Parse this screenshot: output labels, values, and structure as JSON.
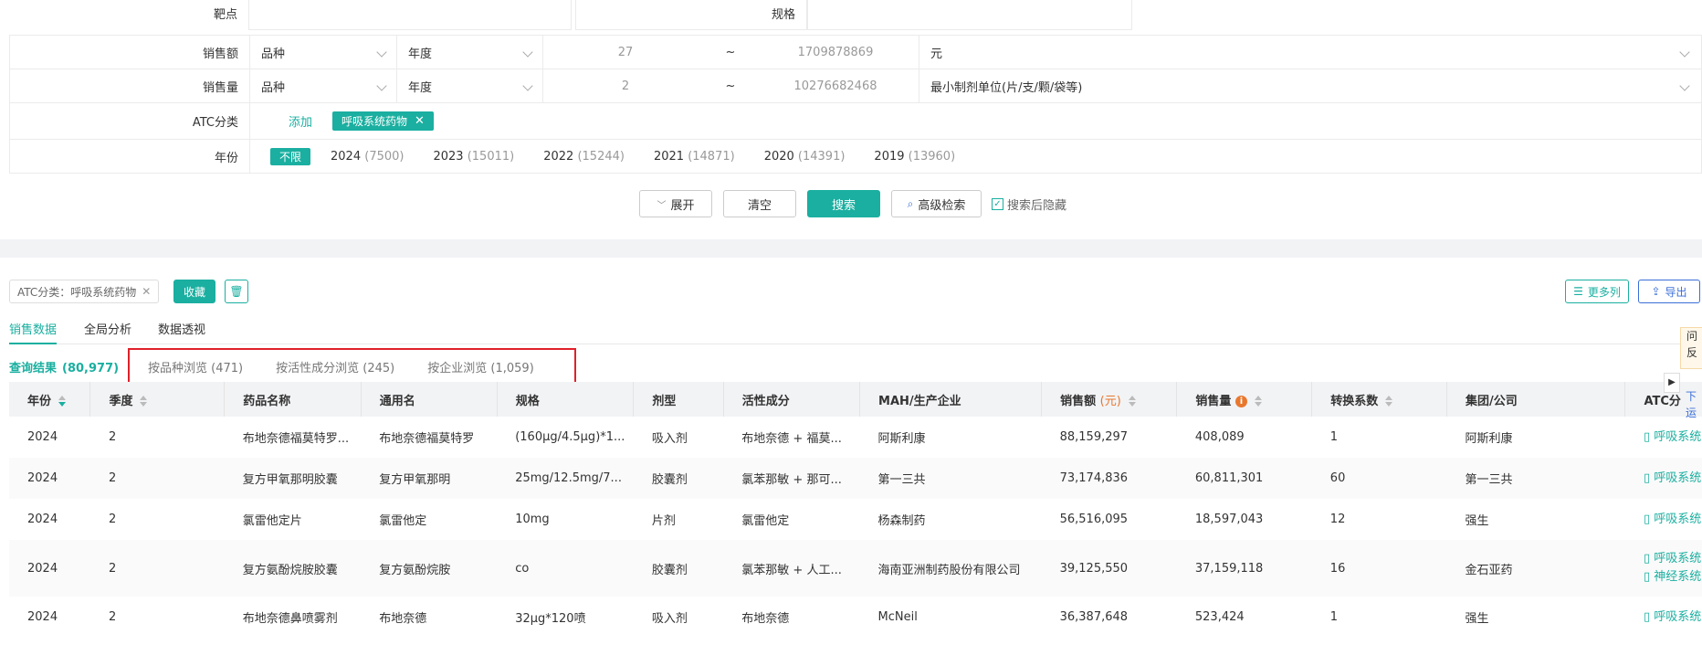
{
  "filter": {
    "target_label": "靶点",
    "spec_label": "规格",
    "sales_amount": {
      "label": "销售额",
      "variety": "品种",
      "year": "年度",
      "min": "27",
      "sep": "~",
      "max": "1709878869",
      "unit": "元"
    },
    "sales_volume": {
      "label": "销售量",
      "variety": "品种",
      "year": "年度",
      "min": "2",
      "sep": "~",
      "max": "10276682468",
      "unit": "最小制剂单位(片/支/颗/袋等)"
    },
    "atc": {
      "label": "ATC分类",
      "add": "添加",
      "tag": "呼吸系统药物"
    },
    "year_filter": {
      "label": "年份",
      "unlimited": "不限",
      "items": [
        {
          "year": "2024",
          "count": "(7500)"
        },
        {
          "year": "2023",
          "count": "(15011)"
        },
        {
          "year": "2022",
          "count": "(15244)"
        },
        {
          "year": "2021",
          "count": "(14871)"
        },
        {
          "year": "2020",
          "count": "(14391)"
        },
        {
          "year": "2019",
          "count": "(13960)"
        }
      ]
    }
  },
  "actions": {
    "expand": "展开",
    "clear": "清空",
    "search": "搜索",
    "advanced": "高级检索",
    "hide_after_search": "搜索后隐藏"
  },
  "toolbar": {
    "chip": "ATC分类：呼吸系统药物",
    "collect": "收藏",
    "more_columns": "更多列",
    "export": "导出"
  },
  "tabs": [
    "销售数据",
    "全局分析",
    "数据透视"
  ],
  "result": {
    "label": "查询结果",
    "count": "(80,977)"
  },
  "subtabs": [
    {
      "label": "按品种浏览",
      "count": "(471)"
    },
    {
      "label": "按活性成分浏览",
      "count": "(245)"
    },
    {
      "label": "按企业浏览",
      "count": "(1,059)"
    }
  ],
  "colors": {
    "accent": "#1aafa0",
    "highlight_box": "#e0202a",
    "yuan": "#e8772e"
  },
  "table": {
    "headers": [
      "年份",
      "季度",
      "药品名称",
      "通用名",
      "规格",
      "剂型",
      "活性成分",
      "MAH/生产企业",
      "销售额",
      "销售量",
      "转换系数",
      "集团/公司",
      "ATC分"
    ],
    "yuan": "(元)",
    "rows": [
      {
        "year": "2024",
        "q": "2",
        "name": "布地奈德福莫特罗...",
        "generic": "布地奈德福莫特罗",
        "spec": "(160μg/4.5μg)*1...",
        "form": "吸入剂",
        "active": "布地奈德 + 福莫...",
        "mah": "阿斯利康",
        "amount": "88,159,297",
        "volume": "408,089",
        "factor": "1",
        "group": "阿斯利康",
        "atc": [
          "呼吸系统"
        ]
      },
      {
        "year": "2024",
        "q": "2",
        "name": "复方甲氧那明胶囊",
        "generic": "复方甲氧那明",
        "spec": "25mg/12.5mg/7...",
        "form": "胶囊剂",
        "active": "氯苯那敏 + 那可...",
        "mah": "第一三共",
        "amount": "73,174,836",
        "volume": "60,811,301",
        "factor": "60",
        "group": "第一三共",
        "atc": [
          "呼吸系统"
        ]
      },
      {
        "year": "2024",
        "q": "2",
        "name": "氯雷他定片",
        "generic": "氯雷他定",
        "spec": "10mg",
        "form": "片剂",
        "active": "氯雷他定",
        "mah": "杨森制药",
        "amount": "56,516,095",
        "volume": "18,597,043",
        "factor": "12",
        "group": "强生",
        "atc": [
          "呼吸系统"
        ]
      },
      {
        "year": "2024",
        "q": "2",
        "name": "复方氨酚烷胺胶囊",
        "generic": "复方氨酚烷胺",
        "spec": "co",
        "form": "胶囊剂",
        "active": "氯苯那敏 + 人工...",
        "mah": "海南亚洲制药股份有限公司",
        "amount": "39,125,550",
        "volume": "37,159,118",
        "factor": "16",
        "group": "金石亚药",
        "atc": [
          "呼吸系统",
          "神经系统"
        ]
      },
      {
        "year": "2024",
        "q": "2",
        "name": "布地奈德鼻喷雾剂",
        "generic": "布地奈德",
        "spec": "32μg*120喷",
        "form": "吸入剂",
        "active": "布地奈德",
        "mah": "McNeil",
        "amount": "36,387,648",
        "volume": "523,424",
        "factor": "1",
        "group": "强生",
        "atc": [
          "呼吸系统"
        ]
      }
    ]
  },
  "side_tab": {
    "text1": "问",
    "text2": "反",
    "text3": "下",
    "text4": "运"
  }
}
